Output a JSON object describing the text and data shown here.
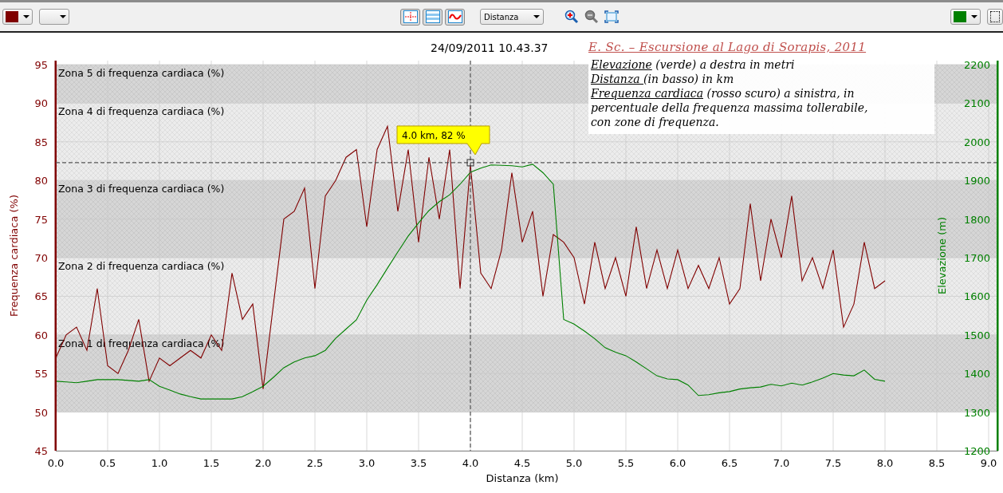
{
  "toolbar": {
    "left": [
      {
        "kind": "color",
        "color": "#800000"
      },
      {
        "kind": "blank"
      }
    ],
    "tools": [
      {
        "kind": "crosshair",
        "disabled": false
      },
      {
        "kind": "bands",
        "disabled": false
      },
      {
        "kind": "wave",
        "disabled": false
      }
    ],
    "select": {
      "value": "Distanza"
    },
    "zoom": [
      {
        "kind": "zoom-in",
        "disabled": false
      },
      {
        "kind": "zoom-out",
        "disabled": true
      },
      {
        "kind": "fit",
        "disabled": false
      }
    ],
    "right": [
      {
        "kind": "color",
        "color": "#008000"
      },
      {
        "kind": "blank"
      }
    ]
  },
  "timestamp": "24/09/2011 10.43.37",
  "legend": {
    "title": "E. Sc. – Escursione al Lago di Sorapis, 2011",
    "lines": [
      {
        "term": "Elevazione",
        "text": " (verde) a destra in metri"
      },
      {
        "term": "Distanza ",
        "text": "(in basso) in km"
      },
      {
        "term": "Frequenza cardiaca",
        "text": " (rosso scuro) a sinistra, in"
      },
      {
        "text": "percentuale della frequenza massima tollerabile,"
      },
      {
        "text": " con zone di frequenza."
      }
    ]
  },
  "chart_data": {
    "type": "line",
    "xlabel": "Distanza (km)",
    "ylabel": "Frequenza cardiaca (%)",
    "y2label": "Elevazione (m)",
    "xlim": [
      0,
      9
    ],
    "ylim": [
      45,
      95
    ],
    "y2lim": [
      1200,
      2200
    ],
    "xticks": [
      {
        "value": 0,
        "label": "0.0"
      },
      {
        "value": 0.5,
        "label": "0.5"
      },
      {
        "value": 1,
        "label": "1.0"
      },
      {
        "value": 1.5,
        "label": "1.5"
      },
      {
        "value": 2,
        "label": "2.0"
      },
      {
        "value": 2.5,
        "label": "2.5"
      },
      {
        "value": 3,
        "label": "3.0"
      },
      {
        "value": 3.5,
        "label": "3.5"
      },
      {
        "value": 4,
        "label": "4.0"
      },
      {
        "value": 4.5,
        "label": "4.5"
      },
      {
        "value": 5,
        "label": "5.0"
      },
      {
        "value": 5.5,
        "label": "5.5"
      },
      {
        "value": 6,
        "label": "6.0"
      },
      {
        "value": 6.5,
        "label": "6.5"
      },
      {
        "value": 7,
        "label": "7.0"
      },
      {
        "value": 7.5,
        "label": "7.5"
      },
      {
        "value": 8,
        "label": "8.0"
      },
      {
        "value": 8.5,
        "label": "8.5"
      },
      {
        "value": 9,
        "label": "9.0"
      }
    ],
    "yticks": [
      45,
      50,
      55,
      60,
      65,
      70,
      75,
      80,
      85,
      90,
      95
    ],
    "y2ticks": [
      1200,
      1300,
      1400,
      1500,
      1600,
      1700,
      1800,
      1900,
      2000,
      2100,
      2200
    ],
    "x": [
      0,
      0.1,
      0.2,
      0.3,
      0.4,
      0.5,
      0.6,
      0.7,
      0.8,
      0.9,
      1,
      1.1,
      1.2,
      1.3,
      1.4,
      1.5,
      1.6,
      1.7,
      1.8,
      1.9,
      2,
      2.1,
      2.2,
      2.3,
      2.4,
      2.5,
      2.6,
      2.7,
      2.8,
      2.9,
      3,
      3.1,
      3.2,
      3.3,
      3.4,
      3.5,
      3.6,
      3.7,
      3.8,
      3.9,
      4,
      4.1,
      4.2,
      4.3,
      4.4,
      4.5,
      4.6,
      4.7,
      4.8,
      4.9,
      5,
      5.1,
      5.2,
      5.3,
      5.4,
      5.5,
      5.6,
      5.7,
      5.8,
      5.9,
      6,
      6.1,
      6.2,
      6.3,
      6.4,
      6.5,
      6.6,
      6.7,
      6.8,
      6.9,
      7,
      7.1,
      7.2,
      7.3,
      7.4,
      7.5,
      7.6,
      7.7,
      7.8,
      7.9,
      8
    ],
    "series": [
      {
        "color": "#800000",
        "values": [
          57,
          60,
          61,
          58,
          66,
          56,
          55,
          58,
          62,
          54,
          57,
          56,
          57,
          58,
          57,
          60,
          58,
          68,
          62,
          64,
          53,
          64,
          75,
          76,
          79,
          66,
          78,
          80,
          83,
          84,
          74,
          84,
          87,
          76,
          84,
          72,
          83,
          75,
          84,
          66,
          82,
          68,
          66,
          71,
          81,
          72,
          76,
          65,
          73,
          72,
          70,
          64,
          72,
          66,
          70,
          65,
          74,
          66,
          71,
          66,
          71,
          66,
          69,
          66,
          70,
          64,
          66,
          77,
          67,
          75,
          70,
          78,
          67,
          70,
          66,
          71,
          61,
          64,
          72,
          66,
          67
        ]
      },
      {
        "color": "#008000",
        "axis": "y2",
        "values": [
          1380,
          1378,
          1376,
          1380,
          1384,
          1384,
          1384,
          1382,
          1380,
          1384,
          1367,
          1357,
          1347,
          1340,
          1334,
          1334,
          1334,
          1334,
          1340,
          1353,
          1367,
          1390,
          1415,
          1430,
          1440,
          1446,
          1460,
          1491,
          1515,
          1539,
          1590,
          1630,
          1673,
          1715,
          1756,
          1790,
          1822,
          1845,
          1863,
          1890,
          1921,
          1932,
          1940,
          1939,
          1938,
          1935,
          1942,
          1920,
          1890,
          1540,
          1528,
          1510,
          1490,
          1467,
          1455,
          1446,
          1430,
          1412,
          1394,
          1386,
          1384,
          1370,
          1343,
          1345,
          1350,
          1353,
          1360,
          1363,
          1365,
          1372,
          1368,
          1375,
          1370,
          1378,
          1388,
          1400,
          1396,
          1394,
          1409,
          1385,
          1380
        ]
      }
    ],
    "bands": [
      {
        "axis": "y",
        "from": 90,
        "to": 95,
        "color": "#d6d6d6",
        "label": "Zona 5 di frequenza cardiaca (%)"
      },
      {
        "axis": "y",
        "from": 80,
        "to": 90,
        "color": "#ececec",
        "label": "Zona 4 di frequenza cardiaca (%)"
      },
      {
        "axis": "y",
        "from": 70,
        "to": 80,
        "color": "#d6d6d6",
        "label": "Zona 3 di frequenza cardiaca (%)"
      },
      {
        "axis": "y",
        "from": 60,
        "to": 70,
        "color": "#ececec",
        "label": "Zona 2 di frequenza cardiaca (%)"
      },
      {
        "axis": "y",
        "from": 50,
        "to": 60,
        "color": "#d6d6d6",
        "label": "Zona 1 di frequenza cardiaca (%)"
      }
    ],
    "ref_lines": [
      {
        "axis": "x",
        "value": 4.0
      },
      {
        "axis": "y",
        "value": 82.3
      }
    ],
    "grid": true,
    "annotations": [
      {
        "x": 4.0,
        "y": 82.3,
        "text": "4.0 km, 82 %"
      }
    ]
  }
}
